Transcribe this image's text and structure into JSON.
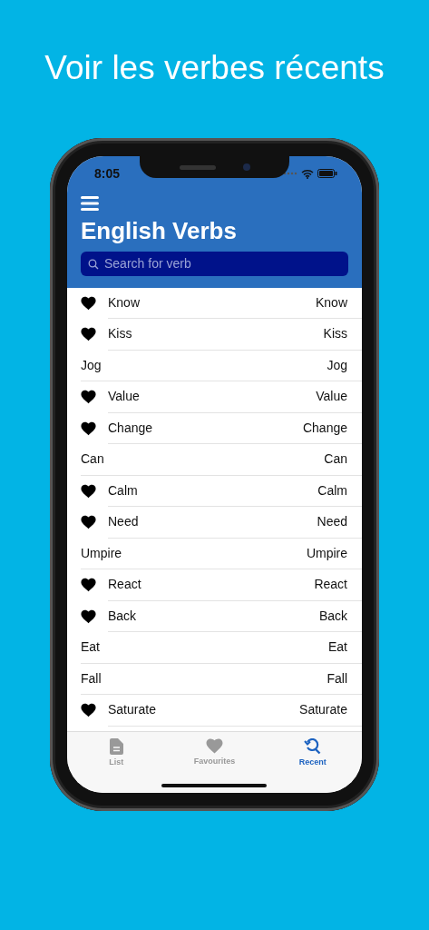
{
  "headline": "Voir les verbes récents",
  "status_bar": {
    "time": "8:05"
  },
  "header": {
    "title": "English Verbs",
    "search": {
      "placeholder": "Search for verb"
    }
  },
  "rows": [
    {
      "word": "Know",
      "translation": "Know",
      "favourite": true
    },
    {
      "word": "Kiss",
      "translation": "Kiss",
      "favourite": true
    },
    {
      "word": "Jog",
      "translation": "Jog",
      "favourite": false
    },
    {
      "word": "Value",
      "translation": "Value",
      "favourite": true
    },
    {
      "word": "Change",
      "translation": "Change",
      "favourite": true
    },
    {
      "word": "Can",
      "translation": "Can",
      "favourite": false
    },
    {
      "word": "Calm",
      "translation": "Calm",
      "favourite": true
    },
    {
      "word": "Need",
      "translation": "Need",
      "favourite": true
    },
    {
      "word": "Umpire",
      "translation": "Umpire",
      "favourite": false
    },
    {
      "word": "React",
      "translation": "React",
      "favourite": true
    },
    {
      "word": "Back",
      "translation": "Back",
      "favourite": true
    },
    {
      "word": "Eat",
      "translation": "Eat",
      "favourite": false
    },
    {
      "word": "Fall",
      "translation": "Fall",
      "favourite": false
    },
    {
      "word": "Saturate",
      "translation": "Saturate",
      "favourite": true
    }
  ],
  "tabs": [
    {
      "label": "List",
      "selected": false
    },
    {
      "label": "Favourites",
      "selected": false
    },
    {
      "label": "Recent",
      "selected": true
    }
  ]
}
